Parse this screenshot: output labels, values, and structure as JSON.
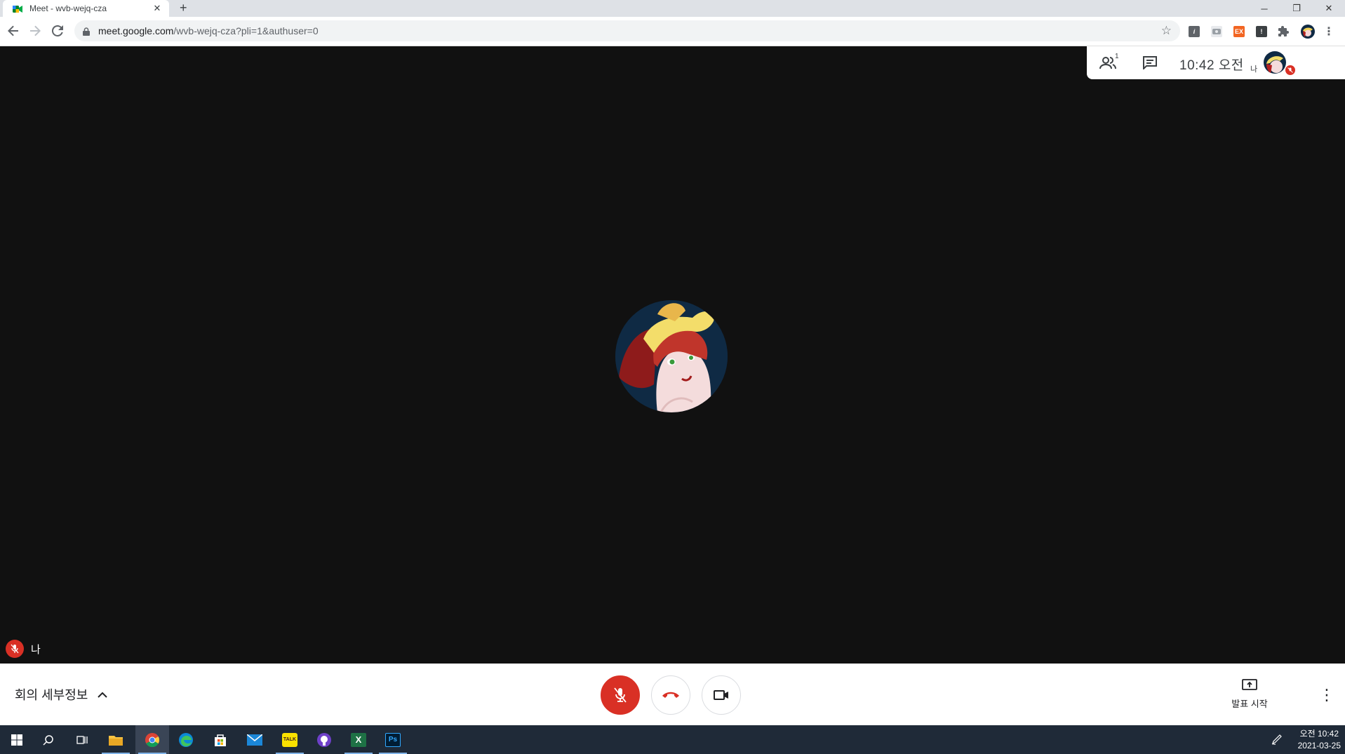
{
  "browser": {
    "tab_title": "Meet - wvb-wejq-cza",
    "tab_close": "✕",
    "new_tab": "+",
    "url_host": "meet.google.com",
    "url_path": "/wvb-wejq-cza?pli=1&authuser=0",
    "window": {
      "minimize": "─",
      "restore": "❐",
      "close": "✕"
    }
  },
  "meet": {
    "time": "10:42 오전",
    "participant_count": "1",
    "self_short": "나",
    "self_name": "나",
    "meeting_details": "회의 세부정보",
    "present_label": "발표 시작"
  },
  "taskbar": {
    "time": "오전 10:42",
    "date": "2021-03-25",
    "apps": [
      "start",
      "search",
      "task-view",
      "file-explorer",
      "chrome",
      "edge",
      "store",
      "mail",
      "kakaotalk",
      "github-desktop",
      "excel",
      "photoshop"
    ]
  },
  "colors": {
    "stage_bg": "#111111",
    "mute_red": "#d93025",
    "taskbar_bg": "#1f2a38"
  }
}
